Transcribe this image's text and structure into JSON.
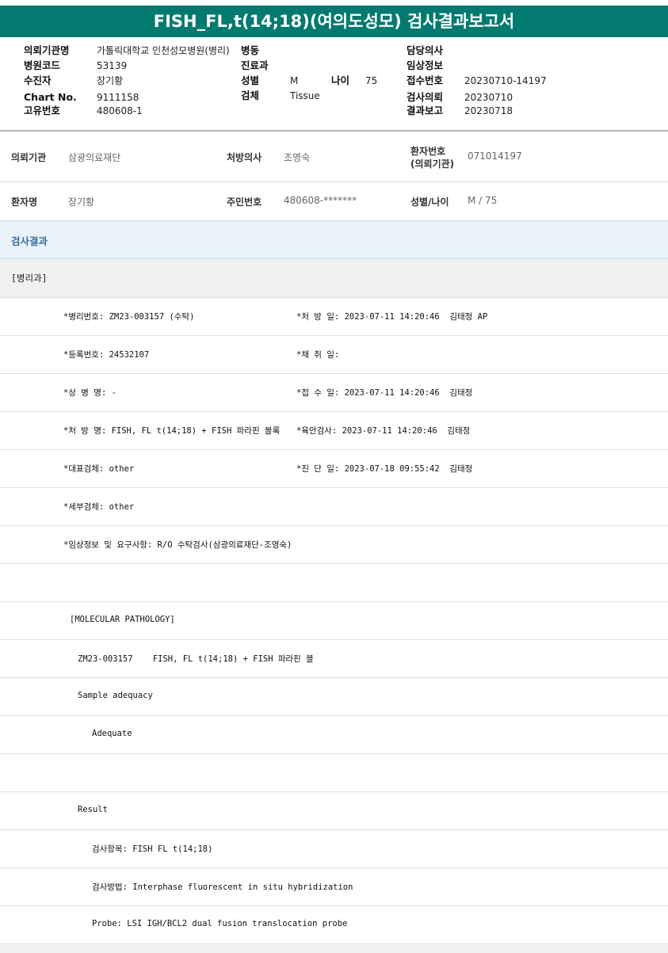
{
  "title": "FISH_FL,t(14;18)(여의도성모) 검사결과보고서",
  "header": {
    "requesting_institution_label": "의뢰기관명",
    "requesting_institution": "가톨릭대학교 인천성모병원(병리)",
    "ward_label": "병동",
    "attending_label": "담당의사",
    "hospital_code_label": "병원코드",
    "hospital_code": "53139",
    "department_label": "진료과",
    "clinical_info_label": "임상정보",
    "patient_label": "수진자",
    "patient": "장기황",
    "sex_label": "성별",
    "sex": "M",
    "age_label": "나이",
    "age": "75",
    "receipt_no_label": "접수번호",
    "receipt_no": "20230710-14197",
    "chart_no_label": "Chart No.",
    "chart_no": "9111158",
    "specimen_label": "검체",
    "specimen": "Tissue",
    "request_date_label": "검사의뢰",
    "request_date": "20230710",
    "unique_no_label": "고유번호",
    "unique_no": "480608-1",
    "report_date_label": "결과보고",
    "report_date": "20230718"
  },
  "meta": {
    "inst_label": "의뢰기관",
    "inst": "삼광의료재단",
    "doctor_label": "처방의사",
    "doctor": "조영숙",
    "patient_no_label_1": "환자번호",
    "patient_no_label_2": "(의뢰기관)",
    "patient_no": "071014197",
    "name_label": "환자명",
    "name": "장기황",
    "id_label": "주민번호",
    "id": "480608-*******",
    "sexage_label": "성별/나이",
    "sexage": "M / 75"
  },
  "section_title": "검사결과",
  "dept": "[병리과]",
  "rows": {
    "r1a": "*병리번호: ZM23-003157 (수탁)",
    "r1b": "*처 방 일: 2023-07-11 14:20:46  김태정 AP",
    "r2a": "*등록번호: 24532107",
    "r2b": "*채 취 일:",
    "r3a": "*상 병 명: -",
    "r3b": "*접 수 일: 2023-07-11 14:20:46  김태정",
    "r4a": "*처 방 명: FISH, FL t(14;18) + FISH 파라핀 블록",
    "r4b": "*육안검사: 2023-07-11 14:20:46  김태정",
    "r5a": "*대표검체: other",
    "r5b": "*진 단 일: 2023-07-18 09:55:42  김태정",
    "r6a": "*세부검체: other",
    "r7a": "*임상정보 및 요구사항: R/O 수탁검사(삼광의료재단-조영숙)",
    "r9": "[MOLECULAR PATHOLOGY]",
    "r10": "ZM23-003157    FISH, FL t(14;18) + FISH 파라핀 블",
    "r11": "Sample adequacy",
    "r12": "Adequate",
    "r14": "Result",
    "r15": "검사항목: FISH FL t(14;18)",
    "r16": "검사방법: Interphase fluorescent in situ hybridization",
    "r17": "Probe: LSI IGH/BCL2 dual fusion translocation probe"
  }
}
